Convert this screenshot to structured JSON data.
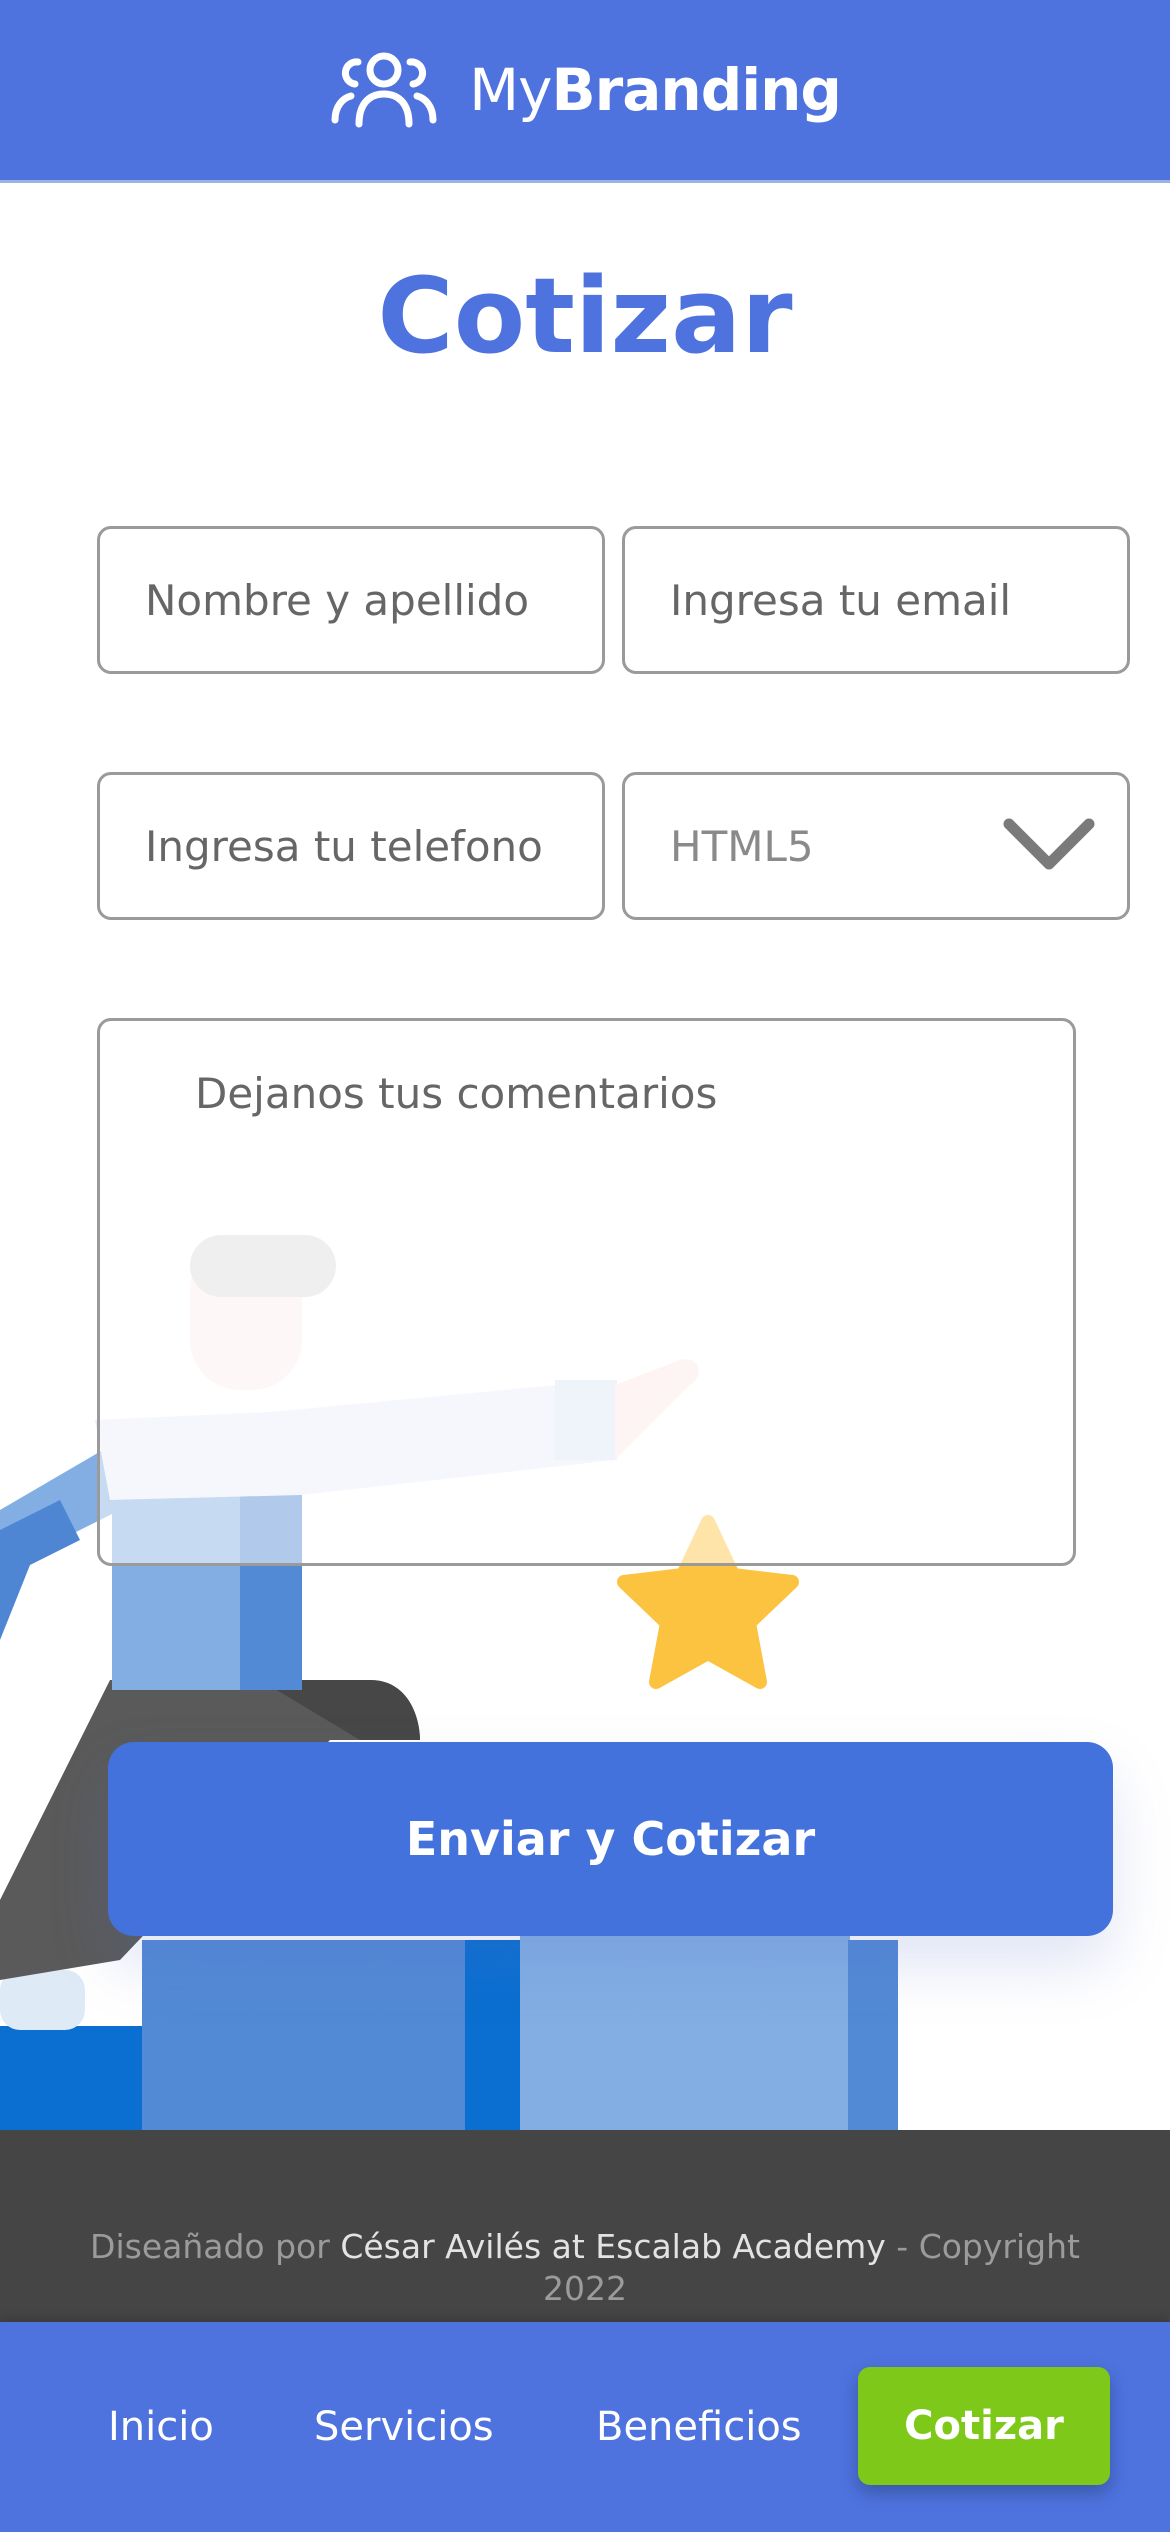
{
  "header": {
    "logo_icon": "users-icon",
    "brand_prefix": "My",
    "brand_suffix": "Branding"
  },
  "main": {
    "title": "Cotizar"
  },
  "form": {
    "name_placeholder": "Nombre y apellido",
    "email_placeholder": "Ingresa tu email",
    "phone_placeholder": "Ingresa tu telefono",
    "select_value": "HTML5",
    "comments_placeholder": "Dejanos tus comentarios",
    "submit_label": "Enviar y Cotizar"
  },
  "footer": {
    "designed_by": "Diseañado por",
    "author": "César Avilés at Escalab Academy",
    "copyright": "- Copyright 2022"
  },
  "bottom_nav": {
    "items": [
      "Inicio",
      "Servicios",
      "Beneficios"
    ],
    "cta": "Cotizar"
  },
  "colors": {
    "primary": "#4e73df",
    "button": "#4472dc",
    "cta": "#7ec81a",
    "footer_bg": "#454545"
  }
}
